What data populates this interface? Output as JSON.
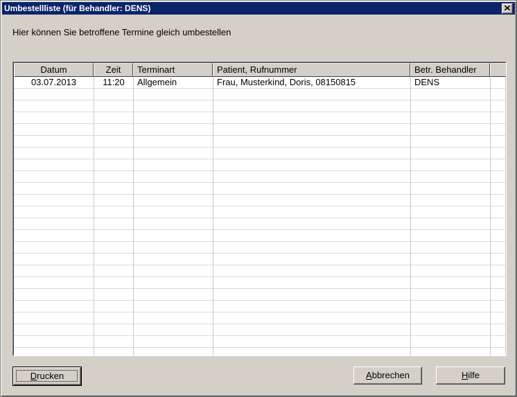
{
  "window": {
    "title": "Umbestellliste (für Behandler: DENS)",
    "close_icon": "close-icon"
  },
  "intro_text": "Hier können Sie betroffene Termine gleich umbestellen",
  "table": {
    "columns": [
      "Datum",
      "Zeit",
      "Terminart",
      "Patient, Rufnummer",
      "Betr. Behandler",
      ""
    ],
    "rows": [
      {
        "datum": "03.07.2013",
        "zeit": "11:20",
        "terminart": "Allgemein",
        "patient": "Frau, Musterkind, Doris, 08150815",
        "behandler": "DENS"
      }
    ]
  },
  "buttons": {
    "print": {
      "mnemonic": "D",
      "rest": "rucken"
    },
    "cancel": {
      "mnemonic": "A",
      "rest": "bbrechen"
    },
    "help": {
      "mnemonic": "H",
      "rest": "ilfe"
    }
  }
}
